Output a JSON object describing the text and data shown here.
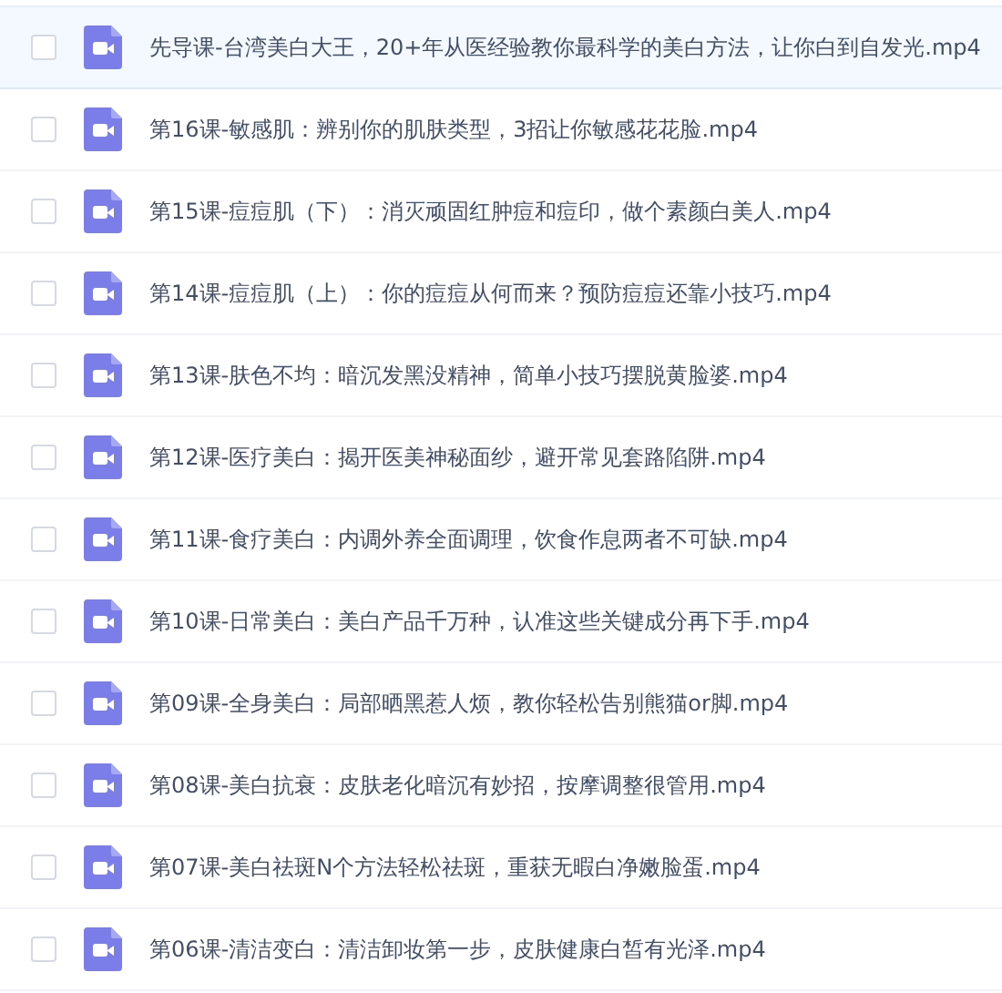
{
  "files": [
    {
      "name": "先导课-台湾美白大王，20+年从医经验教你最科学的美白方法，让你白到自发光.mp4",
      "selected": true,
      "checked": false
    },
    {
      "name": "第16课-敏感肌：辨别你的肌肤类型，3招让你敏感花花脸.mp4",
      "selected": false,
      "checked": false
    },
    {
      "name": "第15课-痘痘肌（下）：消灭顽固红肿痘和痘印，做个素颜白美人.mp4",
      "selected": false,
      "checked": false
    },
    {
      "name": "第14课-痘痘肌（上）：你的痘痘从何而来？预防痘痘还靠小技巧.mp4",
      "selected": false,
      "checked": false
    },
    {
      "name": "第13课-肤色不均：暗沉发黑没精神，简单小技巧摆脱黄脸婆.mp4",
      "selected": false,
      "checked": false
    },
    {
      "name": "第12课-医疗美白：揭开医美神秘面纱，避开常见套路陷阱.mp4",
      "selected": false,
      "checked": false
    },
    {
      "name": "第11课-食疗美白：内调外养全面调理，饮食作息两者不可缺.mp4",
      "selected": false,
      "checked": false
    },
    {
      "name": "第10课-日常美白：美白产品千万种，认准这些关键成分再下手.mp4",
      "selected": false,
      "checked": false
    },
    {
      "name": "第09课-全身美白：局部晒黑惹人烦，教你轻松告别熊猫or脚.mp4",
      "selected": false,
      "checked": false
    },
    {
      "name": "第08课-美白抗衰：皮肤老化暗沉有妙招，按摩调整很管用.mp4",
      "selected": false,
      "checked": false
    },
    {
      "name": "第07课-美白祛斑N个方法轻松祛斑，重获无暇白净嫩脸蛋.mp4",
      "selected": false,
      "checked": false
    },
    {
      "name": "第06课-清洁变白：清洁卸妆第一步，皮肤健康白皙有光泽.mp4",
      "selected": false,
      "checked": false
    }
  ]
}
